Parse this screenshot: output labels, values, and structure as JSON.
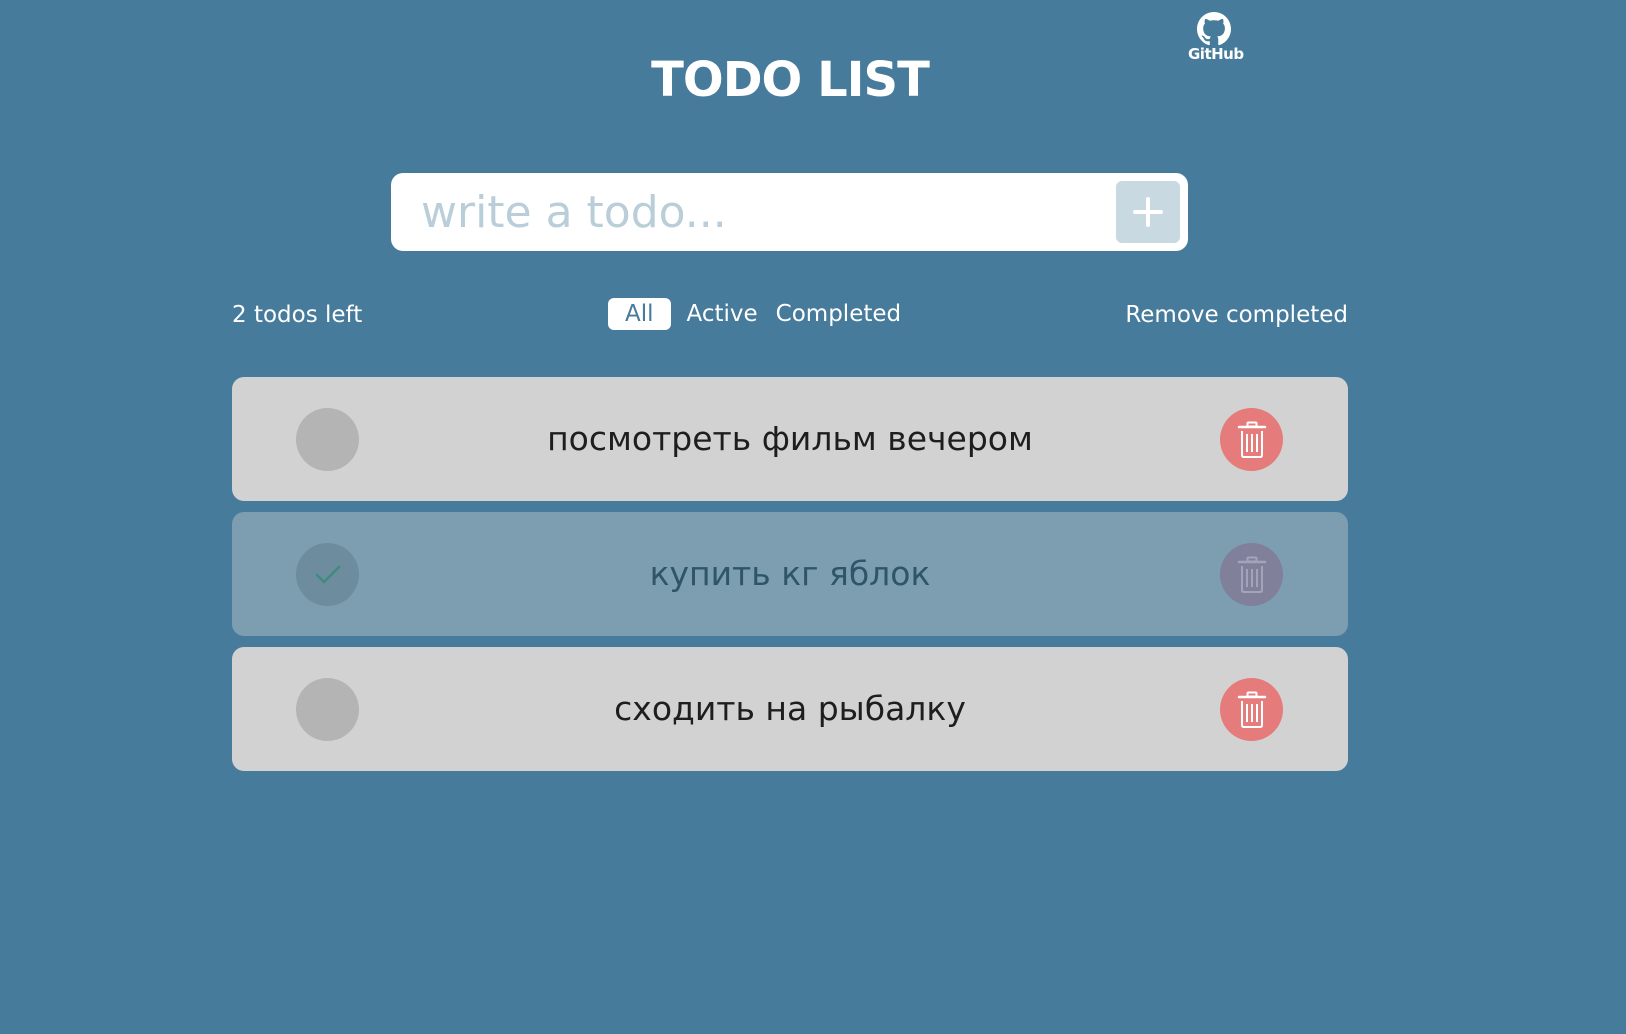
{
  "header": {
    "title": "TODO LIST",
    "github_label": "GitHub"
  },
  "input": {
    "placeholder": "write a todo...",
    "value": "",
    "add_icon": "plus-icon"
  },
  "controls": {
    "todos_left": "2 todos left",
    "filters": [
      {
        "label": "All",
        "selected": true
      },
      {
        "label": "Active",
        "selected": false
      },
      {
        "label": "Completed",
        "selected": false
      }
    ],
    "remove_completed": "Remove completed"
  },
  "todos": [
    {
      "text": "посмотреть фильм вечером",
      "completed": false
    },
    {
      "text": "купить кг яблок",
      "completed": true
    },
    {
      "text": "сходить на рыбалку",
      "completed": false
    }
  ],
  "colors": {
    "background": "#467b9b",
    "todo_background": "#d2d2d2",
    "completed_background": "#7d9db0",
    "delete_button": "#e67b7b",
    "add_button": "#c9d9e1"
  },
  "icons": {
    "github": "github-icon",
    "check": "check-icon",
    "delete": "trash-icon"
  }
}
